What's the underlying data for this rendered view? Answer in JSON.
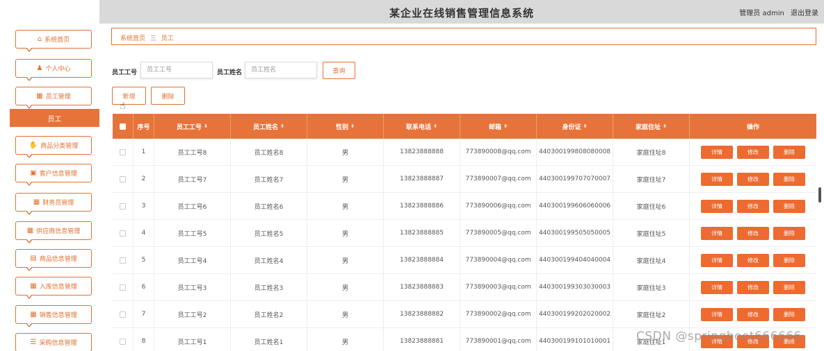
{
  "header": {
    "title": "某企业在线销售管理信息系统",
    "user": "管理员 admin",
    "logout": "退出登录"
  },
  "sidebar": {
    "items": [
      {
        "icon": "home-icon",
        "label": "系统首页"
      },
      {
        "icon": "user-icon",
        "label": "个人中心"
      },
      {
        "icon": "grid-icon",
        "label": "员工管理"
      },
      {
        "icon": "thumb-icon",
        "label": "商品分类管理"
      },
      {
        "icon": "card-icon",
        "label": "客户信息管理"
      },
      {
        "icon": "grid-icon",
        "label": "财务员管理"
      },
      {
        "icon": "table-icon",
        "label": "供应商信息管理"
      },
      {
        "icon": "bag-icon",
        "label": "商品信息管理"
      },
      {
        "icon": "grid-icon",
        "label": "入库信息管理"
      },
      {
        "icon": "grid-icon",
        "label": "销售信息管理"
      },
      {
        "icon": "list-icon",
        "label": "采购信息管理"
      }
    ],
    "active_sub": "员工"
  },
  "breadcrumb": {
    "home": "系统首页",
    "sep": "三",
    "current": "员工"
  },
  "search": {
    "id_label": "员工工号",
    "id_placeholder": "员工工号",
    "name_label": "员工姓名",
    "name_placeholder": "员工姓名",
    "query_button": "查询"
  },
  "actions": {
    "add": "新增",
    "delete": "删除"
  },
  "table": {
    "headers": [
      "序号",
      "员工工号",
      "员工姓名",
      "性别",
      "联系电话",
      "邮箱",
      "身份证",
      "家庭住址",
      "操作"
    ],
    "row_buttons": [
      "详情",
      "修改",
      "删除"
    ],
    "rows": [
      {
        "no": "1",
        "id": "员工工号8",
        "name": "员工姓名8",
        "gender": "男",
        "phone": "13823888888",
        "email": "773890008@qq.com",
        "idcard": "440300199808080008",
        "address": "家庭住址8"
      },
      {
        "no": "2",
        "id": "员工工号7",
        "name": "员工姓名7",
        "gender": "男",
        "phone": "13823888887",
        "email": "773890007@qq.com",
        "idcard": "440300199707070007",
        "address": "家庭住址7"
      },
      {
        "no": "3",
        "id": "员工工号6",
        "name": "员工姓名6",
        "gender": "男",
        "phone": "13823888886",
        "email": "773890006@qq.com",
        "idcard": "440300199606060006",
        "address": "家庭住址6"
      },
      {
        "no": "4",
        "id": "员工工号5",
        "name": "员工姓名5",
        "gender": "男",
        "phone": "13823888885",
        "email": "773890005@qq.com",
        "idcard": "440300199505050005",
        "address": "家庭住址5"
      },
      {
        "no": "5",
        "id": "员工工号4",
        "name": "员工姓名4",
        "gender": "男",
        "phone": "13823888884",
        "email": "773890004@qq.com",
        "idcard": "440300199404040004",
        "address": "家庭住址4"
      },
      {
        "no": "6",
        "id": "员工工号3",
        "name": "员工姓名3",
        "gender": "男",
        "phone": "13823888883",
        "email": "773890003@qq.com",
        "idcard": "440300199303030003",
        "address": "家庭住址3"
      },
      {
        "no": "7",
        "id": "员工工号2",
        "name": "员工姓名2",
        "gender": "男",
        "phone": "13823888882",
        "email": "773890002@qq.com",
        "idcard": "440300199202020002",
        "address": "家庭住址2"
      },
      {
        "no": "8",
        "id": "员工工号1",
        "name": "员工姓名1",
        "gender": "男",
        "phone": "13823888881",
        "email": "773890001@qq.com",
        "idcard": "440300199101010001",
        "address": "家庭住址1"
      }
    ]
  },
  "watermark": "CSDN @springboot666666",
  "colors": {
    "accent": "#e8733a",
    "topbar": "#d9d9d9"
  }
}
